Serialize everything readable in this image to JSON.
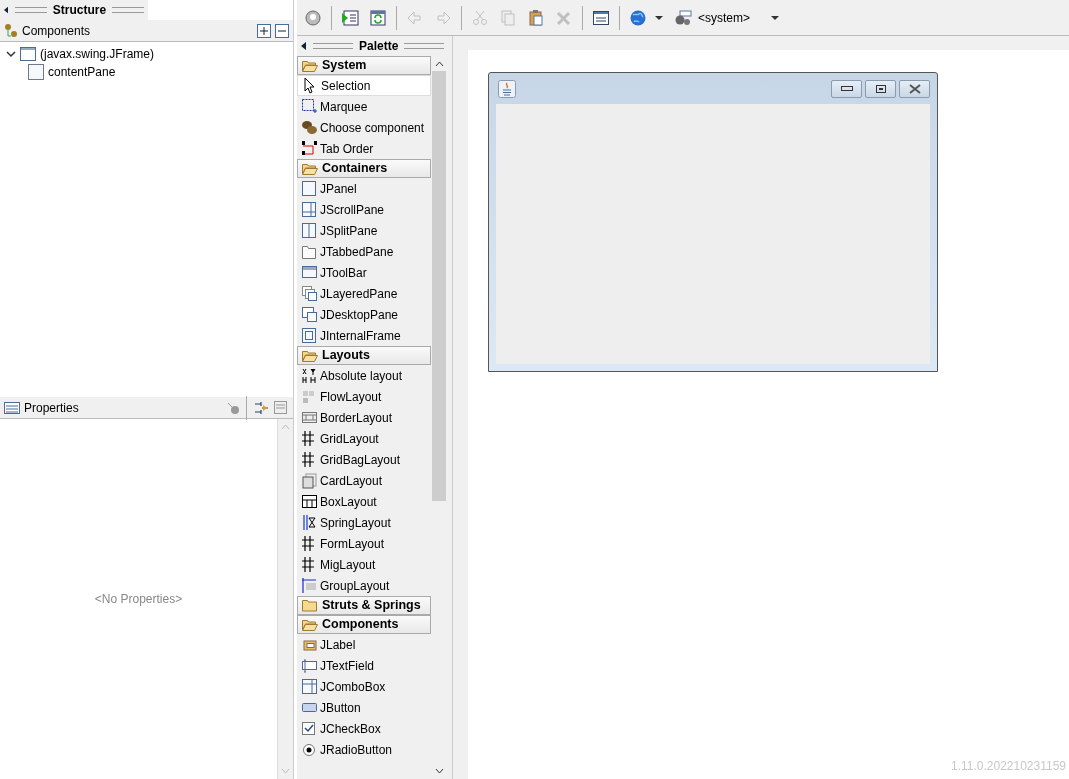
{
  "structure": {
    "title": "Structure",
    "components_header": "Components",
    "tree": [
      {
        "label": "(javax.swing.JFrame)",
        "expanded": true,
        "children": [
          {
            "label": "contentPane"
          }
        ]
      }
    ]
  },
  "properties": {
    "title": "Properties",
    "empty_text": "<No Properties>"
  },
  "toolbar": {
    "buttons": [
      {
        "disabled": false
      },
      {
        "disabled": false
      },
      {
        "disabled": false
      },
      {
        "disabled": true
      },
      {
        "disabled": true
      },
      {
        "disabled": true
      },
      {
        "disabled": true
      },
      {
        "disabled": false
      },
      {
        "disabled": true
      },
      {
        "disabled": false
      },
      {
        "disabled": false
      }
    ],
    "look_and_feel": "<system>"
  },
  "palette": {
    "title": "Palette",
    "categories": [
      {
        "label": "System",
        "expanded": true,
        "items": [
          {
            "label": "Selection",
            "selected": true
          },
          {
            "label": "Marquee",
            "selected": false
          },
          {
            "label": "Choose component",
            "selected": false
          },
          {
            "label": "Tab Order",
            "selected": false
          }
        ]
      },
      {
        "label": "Containers",
        "expanded": true,
        "items": [
          {
            "label": "JPanel",
            "selected": false
          },
          {
            "label": "JScrollPane",
            "selected": false
          },
          {
            "label": "JSplitPane",
            "selected": false
          },
          {
            "label": "JTabbedPane",
            "selected": false
          },
          {
            "label": "JToolBar",
            "selected": false
          },
          {
            "label": "JLayeredPane",
            "selected": false
          },
          {
            "label": "JDesktopPane",
            "selected": false
          },
          {
            "label": "JInternalFrame",
            "selected": false
          }
        ]
      },
      {
        "label": "Layouts",
        "expanded": true,
        "items": [
          {
            "label": "Absolute layout",
            "selected": false
          },
          {
            "label": "FlowLayout",
            "selected": false
          },
          {
            "label": "BorderLayout",
            "selected": false
          },
          {
            "label": "GridLayout",
            "selected": false
          },
          {
            "label": "GridBagLayout",
            "selected": false
          },
          {
            "label": "CardLayout",
            "selected": false
          },
          {
            "label": "BoxLayout",
            "selected": false
          },
          {
            "label": "SpringLayout",
            "selected": false
          },
          {
            "label": "FormLayout",
            "selected": false
          },
          {
            "label": "MigLayout",
            "selected": false
          },
          {
            "label": "GroupLayout",
            "selected": false
          }
        ]
      },
      {
        "label": "Struts & Springs",
        "expanded": false
      },
      {
        "label": "Components",
        "expanded": true,
        "items": [
          {
            "label": "JLabel",
            "selected": false
          },
          {
            "label": "JTextField",
            "selected": false
          },
          {
            "label": "JComboBox",
            "selected": false
          },
          {
            "label": "JButton",
            "selected": false
          },
          {
            "label": "JCheckBox",
            "selected": false
          },
          {
            "label": "JRadioButton",
            "selected": false
          }
        ]
      }
    ]
  },
  "version": "1.11.0.202210231159"
}
